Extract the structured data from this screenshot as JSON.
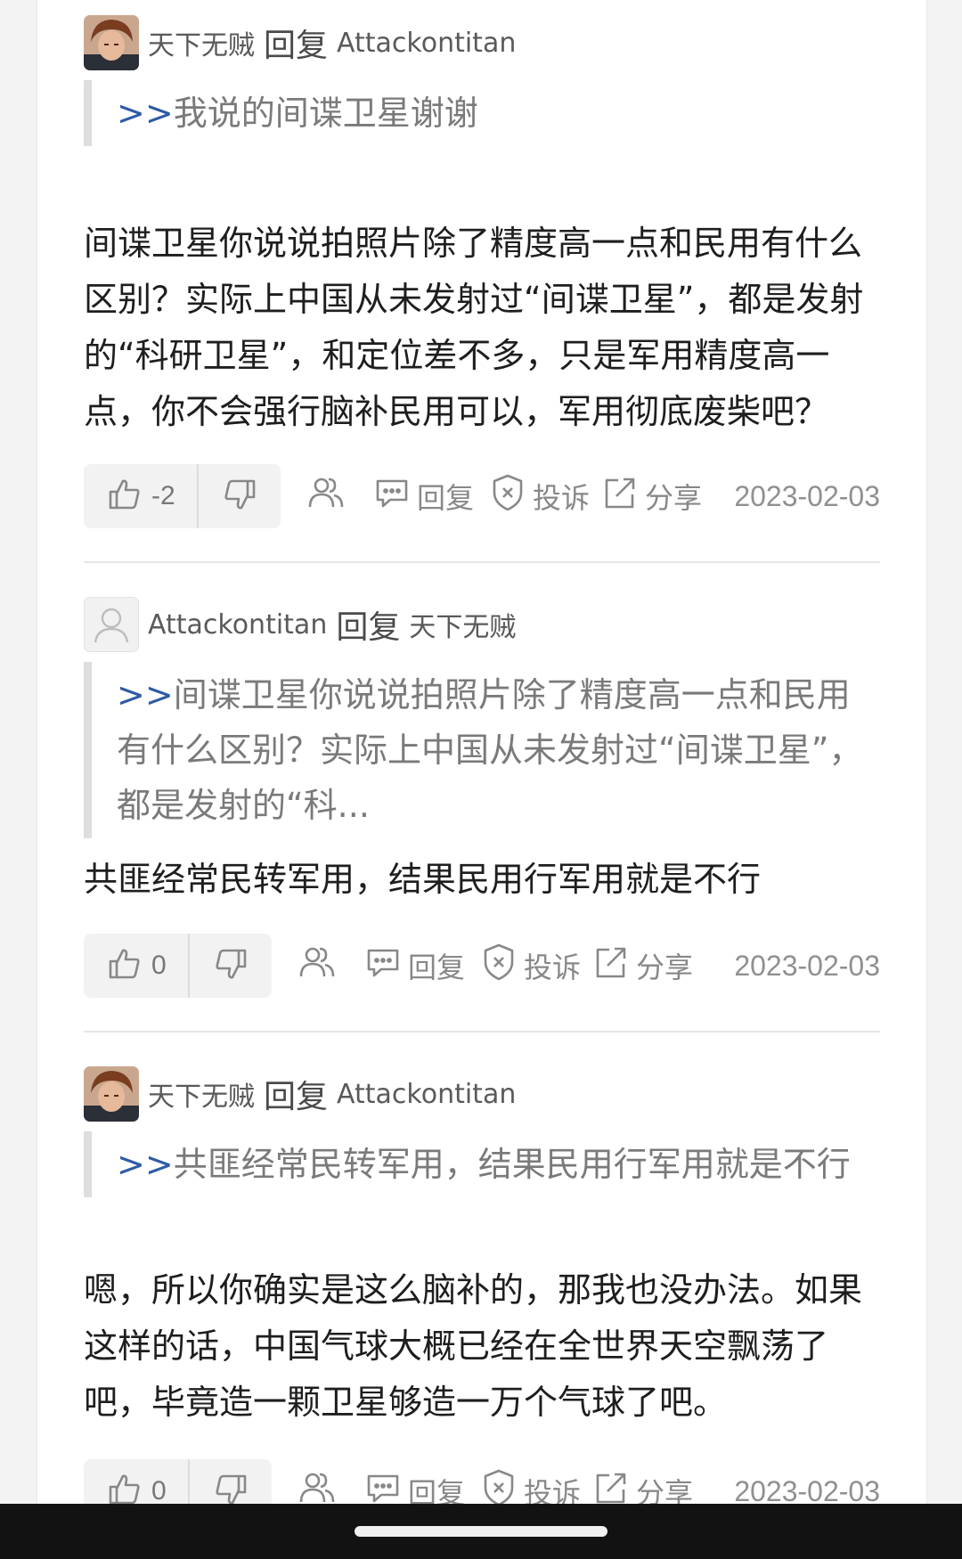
{
  "comments": [
    {
      "author": "天下无贼",
      "reply_word": "回复",
      "target": "Attackontitan",
      "avatar": "photo-avatar",
      "quote_prefix": ">>",
      "quote": "我说的间谍卫星谢谢",
      "body": "间谍卫星你说说拍照片除了精度高一点和民用有什么区别？实际上中国从未发射过“间谍卫星”，都是发射的“科研卫星”，和定位差不多，只是军用精度高一点，你不会强行脑补民用可以，军用彻底废柴吧？",
      "votes": "-2",
      "reply_label": "回复",
      "report_label": "投诉",
      "share_label": "分享",
      "date": "2023-02-03"
    },
    {
      "author": "Attackontitan",
      "reply_word": "回复",
      "target": "天下无贼",
      "avatar": "default-avatar",
      "quote_prefix": ">>",
      "quote": "间谍卫星你说说拍照片除了精度高一点和民用有什么区别？实际上中国从未发射过“间谍卫星”，都是发射的“科...",
      "body": "共匪经常民转军用，结果民用行军用就是不行",
      "votes": "0",
      "reply_label": "回复",
      "report_label": "投诉",
      "share_label": "分享",
      "date": "2023-02-03"
    },
    {
      "author": "天下无贼",
      "reply_word": "回复",
      "target": "Attackontitan",
      "avatar": "photo-avatar",
      "quote_prefix": ">>",
      "quote": "共匪经常民转军用，结果民用行军用就是不行",
      "body": "嗯，所以你确实是这么脑补的，那我也没办法。如果这样的话，中国气球大概已经在全世界天空飘荡了吧，毕竟造一颗卫星够造一万个气球了吧。",
      "votes": "0",
      "reply_label": "回复",
      "report_label": "投诉",
      "share_label": "分享",
      "date": "2023-02-03"
    }
  ],
  "colors": {
    "quote_prefix": "#2e5aa6",
    "page_bg": "#ffffff",
    "outer_bg": "#f3f3f3",
    "vote_bg": "#f2f2f2",
    "navbar": "#121212"
  },
  "icons": {
    "like": "thumbs-up-icon",
    "dislike": "thumbs-down-icon",
    "users": "users-icon",
    "reply": "chat-bubble-icon",
    "report": "shield-x-icon",
    "share": "share-icon"
  }
}
